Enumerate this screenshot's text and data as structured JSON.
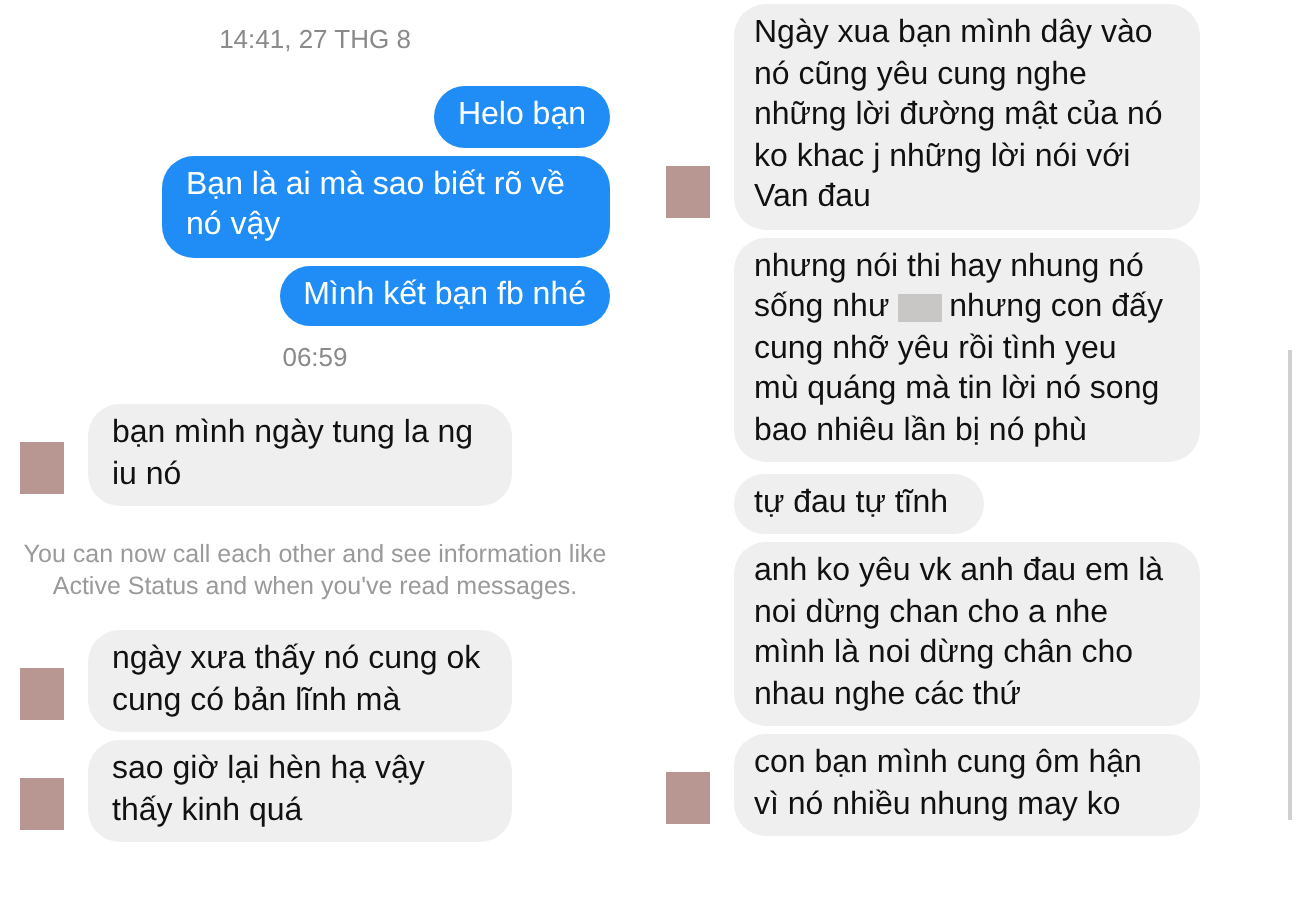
{
  "left_panel": {
    "items": [
      {
        "kind": "timestamp",
        "text": "14:41, 27 THG 8"
      },
      {
        "kind": "outgoing",
        "parts": [
          {
            "kind": "text",
            "text": "Helo bạn"
          }
        ]
      },
      {
        "kind": "outgoing",
        "parts": [
          {
            "kind": "text",
            "text": "Bạn là ai mà sao biết rõ về nó vậy"
          }
        ]
      },
      {
        "kind": "outgoing",
        "parts": [
          {
            "kind": "text",
            "text": "Mình kết bạn fb nhé"
          }
        ]
      },
      {
        "kind": "timestamp",
        "text": "06:59"
      },
      {
        "kind": "incoming",
        "show_avatar": true,
        "parts": [
          {
            "kind": "text",
            "text": "bạn mình ngày tung la ng iu nó"
          }
        ]
      },
      {
        "kind": "notice",
        "text": "You can now call each other and see information like Active Status and when you've read messages."
      },
      {
        "kind": "incoming",
        "show_avatar": true,
        "parts": [
          {
            "kind": "text",
            "text": "ngày xưa thấy nó cung ok cung có bản lĩnh mà"
          }
        ]
      },
      {
        "kind": "incoming",
        "show_avatar": true,
        "parts": [
          {
            "kind": "text",
            "text": "sao giờ lại hèn hạ vậy thấy kinh quá"
          }
        ]
      }
    ]
  },
  "right_panel": {
    "items": [
      {
        "kind": "incoming",
        "show_avatar": true,
        "parts": [
          {
            "kind": "text",
            "text": "Ngày xua bạn mình dây vào nó cũng yêu cung nghe những lời đường mật của nó ko khac j những lời nói với Van đau"
          }
        ]
      },
      {
        "kind": "incoming",
        "show_avatar": false,
        "parts": [
          {
            "kind": "text",
            "text": "nhưng nói thi hay nhung nó sống như"
          },
          {
            "kind": "redacted"
          },
          {
            "kind": "text",
            "text": "nhưng con đấy cung nhỡ yêu rồi tình yeu mù quáng mà tin lời nó song bao nhiêu lần bị nó phù"
          }
        ]
      },
      {
        "kind": "incoming",
        "show_avatar": false,
        "parts": [
          {
            "kind": "text",
            "text": "tự đau tự tĩnh"
          }
        ]
      },
      {
        "kind": "incoming",
        "show_avatar": false,
        "parts": [
          {
            "kind": "text",
            "text": "anh ko yêu vk anh đau em là noi dừng chan cho a nhe mình là noi dừng chân cho nhau nghe các thứ"
          }
        ]
      },
      {
        "kind": "incoming",
        "show_avatar": true,
        "parts": [
          {
            "kind": "text",
            "text": "con bạn mình cung ôm hận vì nó nhiều nhung may ko"
          }
        ]
      }
    ]
  }
}
